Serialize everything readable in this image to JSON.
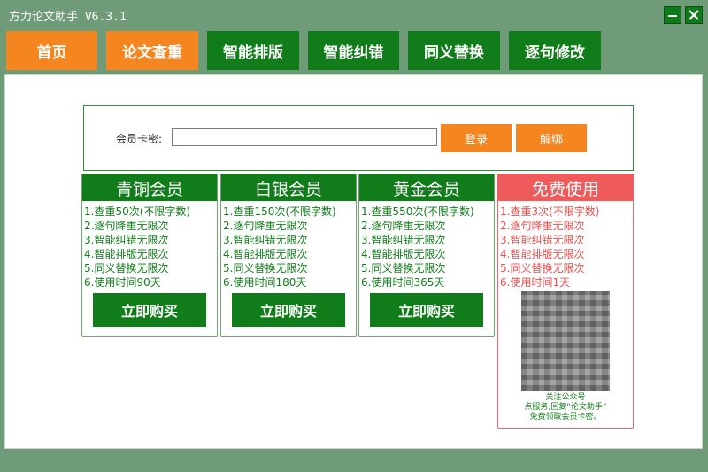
{
  "app": {
    "title": "方力论文助手 V6.3.1",
    "minimize_icon": "minimize-icon",
    "close_icon": "close-icon"
  },
  "nav": {
    "tabs": [
      {
        "label": "首页",
        "color": "#f5851e"
      },
      {
        "label": "论文查重",
        "color": "#f5851e"
      },
      {
        "label": "智能排版",
        "color": "#117d1a"
      },
      {
        "label": "智能纠错",
        "color": "#117d1a"
      },
      {
        "label": "同义替换",
        "color": "#117d1a"
      },
      {
        "label": "逐句修改",
        "color": "#117d1a"
      }
    ]
  },
  "login": {
    "label": "会员卡密:",
    "input_value": "",
    "login_button": "登录",
    "unbind_button": "解绑"
  },
  "plans": [
    {
      "title": "青铜会员",
      "features": [
        "1.查重50次(不限字数)",
        "2.逐句降重无限次",
        "3.智能纠错无限次",
        "4.智能排版无限次",
        "5.同义替换无限次",
        "6.使用时间90天"
      ],
      "button": "立即购买"
    },
    {
      "title": "白银会员",
      "features": [
        "1.查重150次(不限字数)",
        "2.逐句降重无限次",
        "3.智能纠错无限次",
        "4.智能排版无限次",
        "5.同义替换无限次",
        "6.使用时间180天"
      ],
      "button": "立即购买"
    },
    {
      "title": "黄金会员",
      "features": [
        "1.查重550次(不限字数)",
        "2.逐句降重无限次",
        "3.智能纠错无限次",
        "4.智能排版无限次",
        "5.同义替换无限次",
        "6.使用时间365天"
      ],
      "button": "立即购买"
    },
    {
      "title": "免费使用",
      "features": [
        "1.查重3次(不限字数)",
        "2.逐句降重无限次",
        "3.智能纠错无限次",
        "4.智能排版无限次",
        "5.同义替换无限次",
        "6.使用时间1天"
      ],
      "promo": [
        "关注公众号",
        "点服务,回复“论文助手”",
        "免费领取会员卡密。"
      ]
    }
  ],
  "colors": {
    "background": "#6f9b79",
    "accent_orange": "#f5851e",
    "brand_green": "#117d1a",
    "free_red": "#ef5b5b"
  }
}
